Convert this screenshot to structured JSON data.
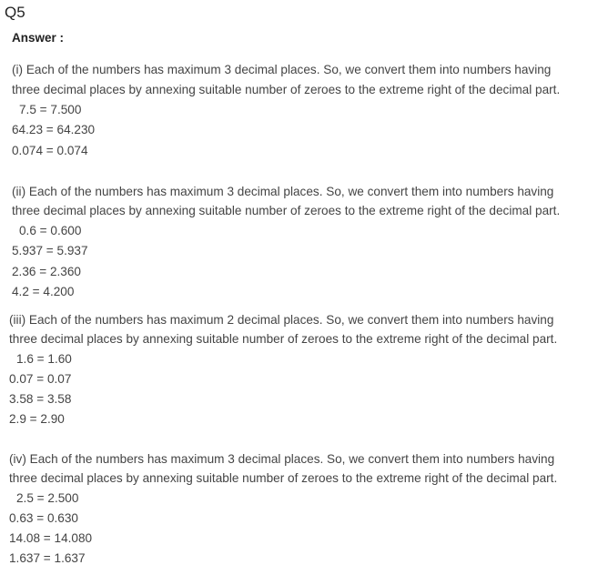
{
  "question_label": "Q5",
  "answer_label": "Answer :",
  "sections": [
    {
      "intro_line1": "(i) Each of the numbers has maximum 3 decimal places. So, we convert them into numbers having",
      "intro_line2": "three decimal places by annexing suitable number of zeroes to the extreme right of the decimal part.",
      "equations": [
        "7.5 = 7.500",
        "64.23 = 64.230",
        "0.074 = 0.074"
      ]
    },
    {
      "intro_line1": "(ii) Each of the numbers has maximum 3 decimal places. So, we convert them into numbers having",
      "intro_line2": "three decimal places by annexing suitable number of zeroes to the extreme right of the decimal part.",
      "equations": [
        "0.6 = 0.600",
        "5.937 = 5.937",
        "2.36 = 2.360",
        "4.2 = 4.200"
      ]
    },
    {
      "intro_line1": "(iii) Each of the numbers has maximum 2 decimal places. So, we convert them into numbers having",
      "intro_line2": "three decimal places by annexing suitable number of zeroes to the extreme right of the decimal part.",
      "equations": [
        "1.6 = 1.60",
        "0.07 = 0.07",
        "3.58 = 3.58",
        "2.9 = 2.90"
      ]
    },
    {
      "intro_line1": "(iv) Each of the numbers has maximum 3 decimal places. So, we convert them into numbers having",
      "intro_line2": "three decimal places by annexing suitable number of zeroes to the extreme right of the decimal part.",
      "equations": [
        "2.5 = 2.500",
        "0.63 = 0.630",
        "14.08 = 14.080",
        "1.637 = 1.637"
      ]
    }
  ]
}
